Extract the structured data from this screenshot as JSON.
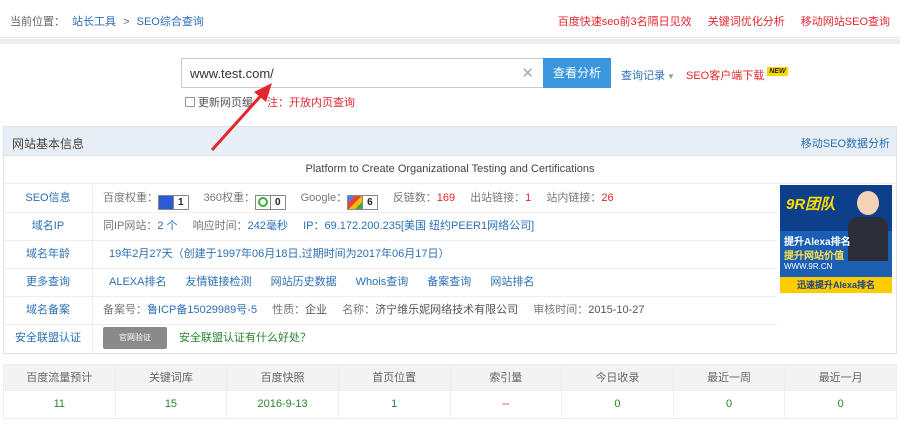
{
  "breadcrumb": {
    "prefix": "当前位置：",
    "home": "站长工具",
    "sep": ">",
    "current": "SEO综合查询"
  },
  "top_links": [
    "百度快速seo前3名隔日见效",
    "关键词优化分析",
    "移动网站SEO查询"
  ],
  "search": {
    "value": "www.test.com/",
    "button": "查看分析",
    "history": "查询记录",
    "client": "SEO客户端下载",
    "new_badge": "NEW",
    "refresh_label": "更新网页缓",
    "note": "注：开放内页查询"
  },
  "panel": {
    "title": "网站基本信息",
    "mobile_link": "移动SEO数据分析",
    "site_title": "Platform to Create Organizational Testing and Certifications"
  },
  "seo": {
    "label": "SEO信息",
    "baidu_label": "百度权重：",
    "baidu_value": "1",
    "s360_label": "360权重：",
    "s360_value": "0",
    "google_label": "Google：",
    "google_value": "6",
    "backlinks_label": "反链数：",
    "backlinks": "169",
    "outlinks_label": "出站链接：",
    "outlinks": "1",
    "inlinks_label": "站内链接：",
    "inlinks": "26"
  },
  "domain_ip": {
    "label": "域名IP",
    "same_ip_label": "同IP网站：",
    "same_ip": "2 个",
    "resp_label": "响应时间：",
    "resp": "242毫秒",
    "ip": "IP：69.172.200.235[美国 纽约PEER1网络公司]"
  },
  "domain_age": {
    "label": "域名年龄",
    "value": "19年2月27天（创建于1997年06月18日,过期时间为2017年06月17日）"
  },
  "more": {
    "label": "更多查询",
    "items": [
      "ALEXA排名",
      "友情链接检测",
      "网站历史数据",
      "Whois查询",
      "备案查询",
      "网站排名"
    ]
  },
  "record": {
    "label": "域名备案",
    "no_label": "备案号：",
    "no": "鲁ICP备15029989号-5",
    "type_label": "性质：",
    "type": "企业",
    "name_label": "名称：",
    "name": "济宁维乐妮网络技术有限公司",
    "time_label": "审核时间：",
    "time": "2015-10-27"
  },
  "safety": {
    "label": "安全联盟认证",
    "badge": "官网验证",
    "link": "安全联盟认证有什么好处？"
  },
  "ad": {
    "logo": "9R团队",
    "line1": "提升Alexa排名",
    "line2": "提升网站价值",
    "url": "WWW.9R.CN",
    "bottom": "迅速提升Alexa排名"
  },
  "stats": {
    "headers": [
      "百度流量预计",
      "关键词库",
      "百度快照",
      "首页位置",
      "索引量",
      "今日收录",
      "最近一周",
      "最近一月"
    ],
    "values": [
      "11",
      "15",
      "2016-9-13",
      "1",
      "--",
      "0",
      "0",
      "0"
    ]
  },
  "colors": {
    "accent": "#3b97dd",
    "link": "#2a6fb5",
    "red": "#e3272c",
    "green": "#26862e"
  }
}
